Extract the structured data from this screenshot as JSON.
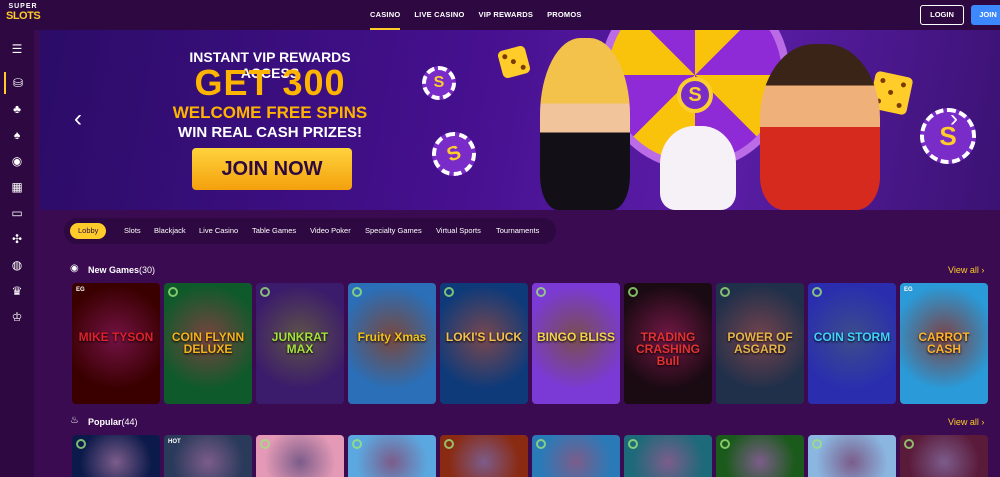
{
  "brand": {
    "logo_top": "SUPER",
    "logo_bottom": "SLOTS"
  },
  "nav": [
    "CASINO",
    "LIVE CASINO",
    "VIP REWARDS",
    "PROMOS"
  ],
  "auth": {
    "login": "LOGIN",
    "join": "JOIN"
  },
  "hero": {
    "line1": "INSTANT VIP REWARDS ACCESS",
    "line2": "GET 300",
    "line3": "WELCOME FREE SPINS",
    "line4": "WIN REAL CASH PRIZES!",
    "cta": "JOIN NOW",
    "prev": "‹",
    "next": "›",
    "wheel_symbol": "S"
  },
  "categories": [
    "Lobby",
    "Slots",
    "Blackjack",
    "Live Casino",
    "Table Games",
    "Video Poker",
    "Specialty Games",
    "Virtual Sports",
    "Tournaments"
  ],
  "sections": {
    "new_games": {
      "title": "New Games",
      "count": "(30)",
      "view_all": "View all ›"
    },
    "popular": {
      "title": "Popular",
      "count": "(44)",
      "view_all": "View all ›"
    }
  },
  "new_games": [
    {
      "title": "MIKE TYSON",
      "tag": "EG",
      "bg": "#3a0000",
      "accent": "#e0202a"
    },
    {
      "title": "COIN FLYNN DELUXE",
      "tag": "",
      "bg": "#0f5a2a",
      "accent": "#f6b21d"
    },
    {
      "title": "JUNKRAT MAX",
      "tag": "",
      "bg": "#3b1b6b",
      "accent": "#a4e23a"
    },
    {
      "title": "Fruity Xmas",
      "tag": "",
      "bg": "#2a6fb8",
      "accent": "#f4c21a"
    },
    {
      "title": "LOKI'S LUCK",
      "tag": "",
      "bg": "#0e3a7a",
      "accent": "#f6c04c"
    },
    {
      "title": "BINGO BLISS",
      "tag": "",
      "bg": "#7b3ad6",
      "accent": "#f6d54a"
    },
    {
      "title": "TRADING CRASHING Bull",
      "tag": "",
      "bg": "#1a0a12",
      "accent": "#e53232"
    },
    {
      "title": "POWER OF ASGARD",
      "tag": "",
      "bg": "#21304a",
      "accent": "#e7b34a"
    },
    {
      "title": "COIN STORM",
      "tag": "",
      "bg": "#2a2eae",
      "accent": "#3fd2ff"
    },
    {
      "title": "CARROT CASH",
      "tag": "EG",
      "bg": "#2a9ad8",
      "accent": "#ffb22e"
    }
  ],
  "popular_games": [
    {
      "bg": "#0b1a4a"
    },
    {
      "bg": "#2a3a5a",
      "tag": "HOT"
    },
    {
      "bg": "#e49ab6"
    },
    {
      "bg": "#5ba8e0"
    },
    {
      "bg": "#8a2a12"
    },
    {
      "bg": "#2a7ab8"
    },
    {
      "bg": "#1d6a7a"
    },
    {
      "bg": "#1a5a1a"
    },
    {
      "bg": "#8ab6e0"
    },
    {
      "bg": "#5a1a3a"
    }
  ],
  "colors": {
    "accent": "#ffcc29",
    "bg": "#3a0b50",
    "panel": "#2e0941",
    "join": "#3b88ff"
  }
}
